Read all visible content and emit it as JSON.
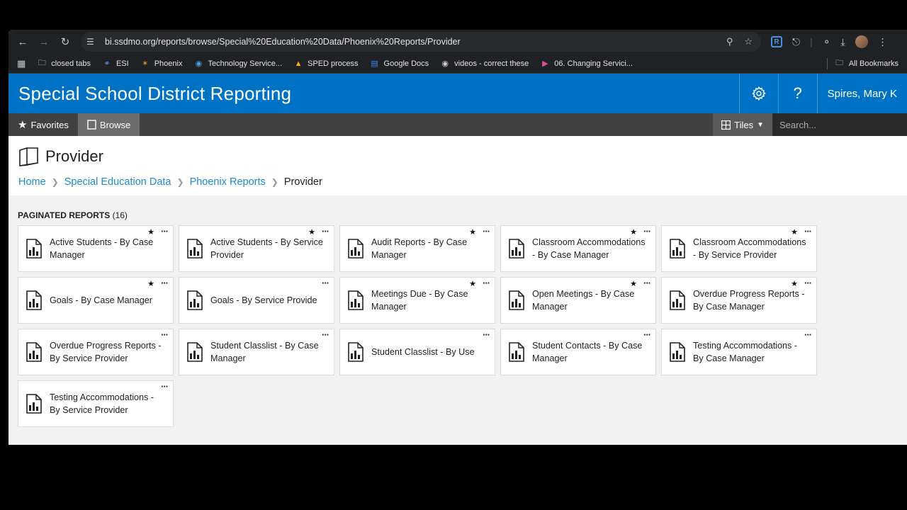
{
  "browser": {
    "url_host": "bi.ssdmo.org",
    "url_path": "/reports/browse/Special%20Education%20Data/Phoenix%20Reports/Provider",
    "bookmarks": [
      {
        "label": "closed tabs",
        "icon": "folder-icon"
      },
      {
        "label": "ESI",
        "icon": "link-icon"
      },
      {
        "label": "Phoenix",
        "icon": "phoenix-icon"
      },
      {
        "label": "Technology Service...",
        "icon": "globe-icon"
      },
      {
        "label": "SPED process",
        "icon": "drive-icon"
      },
      {
        "label": "Google Docs",
        "icon": "docs-icon"
      },
      {
        "label": "videos - correct these",
        "icon": "globe-icon"
      },
      {
        "label": "06. Changing Servici...",
        "icon": "play-icon"
      }
    ],
    "all_bookmarks_label": "All Bookmarks"
  },
  "header": {
    "site_title": "Special School District Reporting",
    "user_name": "Spires, Mary K"
  },
  "nav": {
    "favorites_label": "Favorites",
    "browse_label": "Browse",
    "view_label": "Tiles",
    "search_placeholder": "Search..."
  },
  "page": {
    "title": "Provider",
    "breadcrumb": [
      "Home",
      "Special Education Data",
      "Phoenix Reports"
    ],
    "breadcrumb_current": "Provider"
  },
  "section": {
    "label": "PAGINATED REPORTS",
    "count": "(16)"
  },
  "reports": [
    {
      "name": "Active Students - By Case Manager",
      "favorite": true
    },
    {
      "name": "Active Students - By Service Provider",
      "favorite": true
    },
    {
      "name": "Audit Reports - By Case Manager",
      "favorite": true
    },
    {
      "name": "Classroom Accommodations - By Case Manager",
      "favorite": true
    },
    {
      "name": "Classroom Accommodations - By Service Provider",
      "favorite": true
    },
    {
      "name": "Goals - By Case Manager",
      "favorite": true
    },
    {
      "name": "Goals - By Service Provide",
      "favorite": false
    },
    {
      "name": "Meetings Due - By Case Manager",
      "favorite": true
    },
    {
      "name": "Open Meetings - By Case Manager",
      "favorite": true
    },
    {
      "name": "Overdue Progress Reports - By Case Manager",
      "favorite": true
    },
    {
      "name": "Overdue Progress Reports - By Service Provider",
      "favorite": false
    },
    {
      "name": "Student Classlist - By Case Manager",
      "favorite": false
    },
    {
      "name": "Student Classlist - By Use",
      "favorite": false
    },
    {
      "name": "Student Contacts - By Case Manager",
      "favorite": false
    },
    {
      "name": "Testing Accommodations - By Case Manager",
      "favorite": false
    },
    {
      "name": "Testing Accommodations - By Service Provider",
      "favorite": false
    }
  ],
  "colors": {
    "header_blue": "#0072c6",
    "link_blue": "#1e8bd1",
    "nav_dark": "#414141"
  }
}
